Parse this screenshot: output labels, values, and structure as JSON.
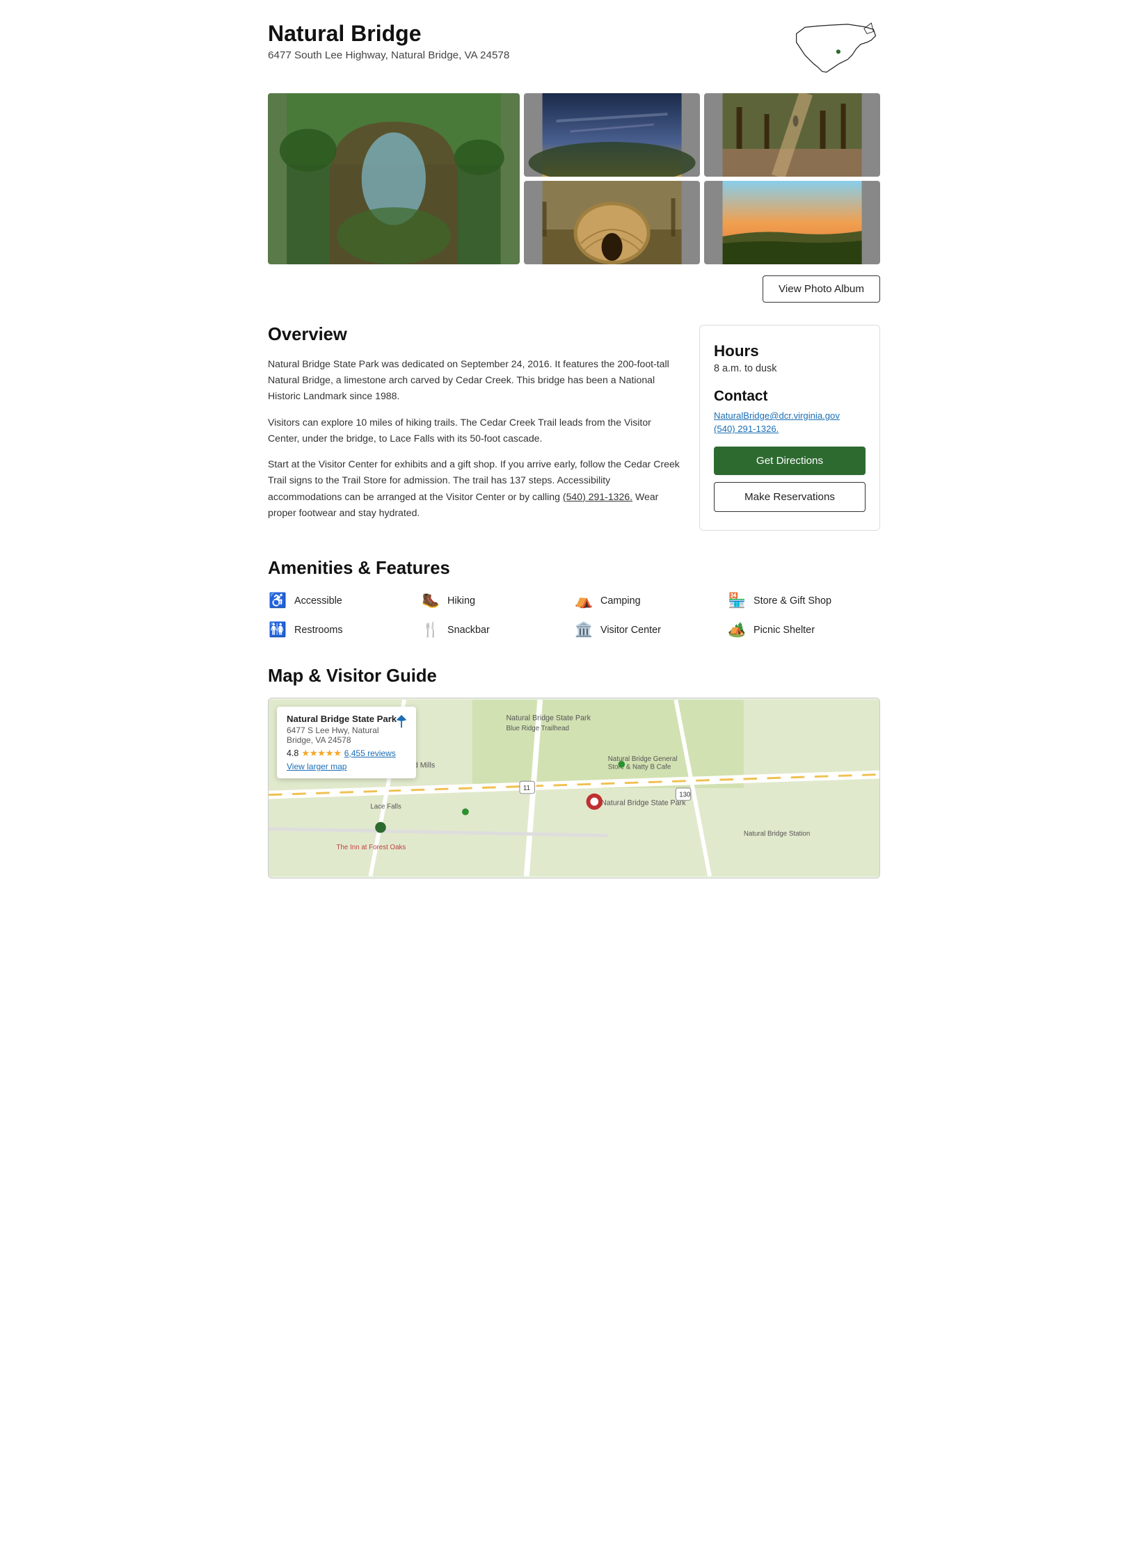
{
  "header": {
    "title": "Natural Bridge",
    "address": "6477 South Lee Highway, Natural Bridge, VA 24578"
  },
  "photo_album": {
    "button_label": "View Photo Album"
  },
  "overview": {
    "heading": "Overview",
    "paragraphs": [
      "Natural Bridge State Park was dedicated on September 24, 2016. It features the 200-foot-tall Natural Bridge, a limestone arch carved by Cedar Creek. This bridge has been a National Historic Landmark since 1988.",
      "Visitors can explore 10 miles of hiking trails. The Cedar Creek Trail leads from the Visitor Center, under the bridge, to Lace Falls with its 50-foot cascade.",
      "Start at the Visitor Center for exhibits and a gift shop. If you arrive early, follow the Cedar Creek Trail signs to the Trail Store for admission. The trail has 137 steps. Accessibility accommodations can be arranged at the Visitor Center or by calling (540) 291-1326. Wear proper footwear and stay hydrated."
    ],
    "phone_link": "(540) 291-1326."
  },
  "sidebar": {
    "hours_heading": "Hours",
    "hours_text": "8 a.m. to dusk",
    "contact_heading": "Contact",
    "email": "NaturalBridge@dcr.virginia.gov",
    "phone": "(540) 291-1326.",
    "directions_label": "Get Directions",
    "reservations_label": "Make Reservations"
  },
  "amenities": {
    "heading": "Amenities & Features",
    "items": [
      {
        "icon": "♿",
        "label": "Accessible",
        "name": "accessible"
      },
      {
        "icon": "🥾",
        "label": "Hiking",
        "name": "hiking"
      },
      {
        "icon": "⛺",
        "label": "Camping",
        "name": "camping"
      },
      {
        "icon": "🏪",
        "label": "Store & Gift Shop",
        "name": "store-gift-shop"
      },
      {
        "icon": "🚻",
        "label": "Restrooms",
        "name": "restrooms"
      },
      {
        "icon": "🍴",
        "label": "Snackbar",
        "name": "snackbar"
      },
      {
        "icon": "🏛️",
        "label": "Visitor Center",
        "name": "visitor-center"
      },
      {
        "icon": "🏕️",
        "label": "Picnic Shelter",
        "name": "picnic-shelter"
      }
    ]
  },
  "map_section": {
    "heading": "Map & Visitor Guide",
    "park_name": "Natural Bridge State Park",
    "park_address": "6477 S Lee Hwy, Natural Bridge, VA 24578",
    "rating": "4.8",
    "review_count": "6,455 reviews",
    "view_larger": "View larger map"
  }
}
